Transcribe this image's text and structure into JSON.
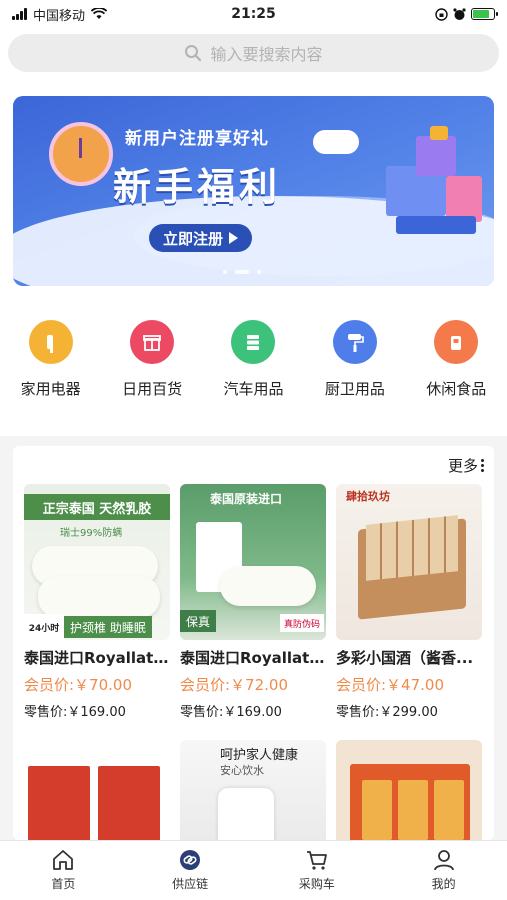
{
  "status_bar": {
    "carrier": "中国移动",
    "time": "21:25",
    "battery_level": 0.8
  },
  "search": {
    "placeholder": "输入要搜索内容"
  },
  "banner": {
    "subtitle": "新用户注册享好礼",
    "title": "新手福利",
    "cta": "立即注册",
    "slide_count": 3,
    "active_slide": 1
  },
  "categories": [
    {
      "label": "家用电器",
      "icon": "appliance-icon",
      "color": "#f5b335"
    },
    {
      "label": "日用百货",
      "icon": "gift-icon",
      "color": "#ec4a62"
    },
    {
      "label": "汽车用品",
      "icon": "car-list-icon",
      "color": "#3cc27a"
    },
    {
      "label": "厨卫用品",
      "icon": "paint-roller-icon",
      "color": "#4f7de9"
    },
    {
      "label": "休闲食品",
      "icon": "snack-icon",
      "color": "#f47a4c"
    }
  ],
  "products": {
    "more_label": "更多",
    "items": [
      {
        "name": "泰国进口Royallat...",
        "member_price": "会员价:￥70.00",
        "retail_price": "零售价:￥169.00",
        "image_text": "正宗泰国 天然乳胶",
        "image_sub": "瑞士99%防螨",
        "image_tag": "护颈椎 助睡眠",
        "image_corner": "24小时"
      },
      {
        "name": "泰国进口Royallat...",
        "member_price": "会员价:￥72.00",
        "retail_price": "零售价:￥169.00",
        "image_text": "泰国原装进口",
        "image_badge": "保真",
        "image_badge2": "真防伪码"
      },
      {
        "name": "多彩小国酒（酱香...",
        "member_price": "会员价:￥47.00",
        "retail_price": "零售价:￥299.00",
        "image_brand": "肆拾玖坊"
      },
      {
        "name": "",
        "member_price": "",
        "retail_price": ""
      },
      {
        "name": "",
        "member_price": "",
        "retail_price": "",
        "image_text": "呵护家人健康",
        "image_sub": "安心饮水"
      },
      {
        "name": "",
        "member_price": "",
        "retail_price": ""
      }
    ]
  },
  "tabbar": [
    {
      "label": "首页",
      "icon": "home-icon"
    },
    {
      "label": "供应链",
      "icon": "supply-chain-icon"
    },
    {
      "label": "采购车",
      "icon": "cart-icon"
    },
    {
      "label": "我的",
      "icon": "user-icon"
    }
  ],
  "colors": {
    "price_accent": "#f08a4b",
    "banner_blue": "#3c66d8"
  }
}
